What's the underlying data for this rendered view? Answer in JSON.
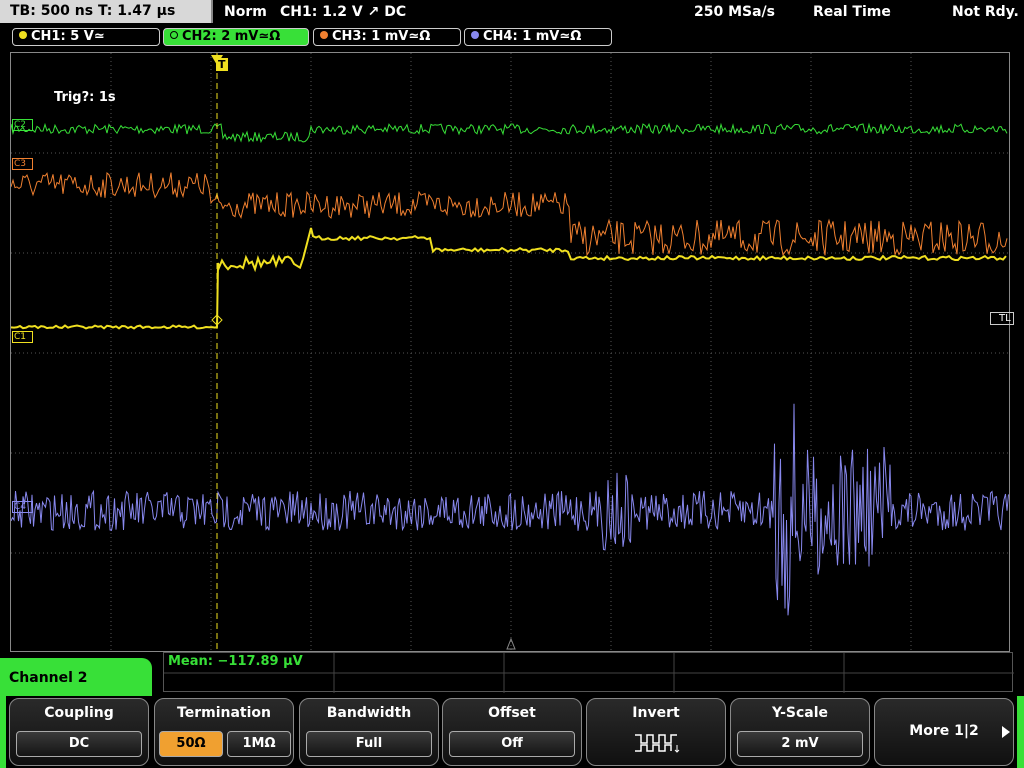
{
  "topbar": {
    "timebase": "TB: 500 ns   T: 1.47 µs",
    "trigger_mode": "Norm",
    "trigger_info": "CH1: 1.2 V ↗ DC",
    "sample_rate": "250 MSa/s",
    "acq_mode": "Real Time",
    "status": "Not Rdy."
  },
  "channels": [
    {
      "label": "CH1: 5 V≃",
      "color": "#f0e020"
    },
    {
      "label": "CH2: 2 mV≃Ω",
      "color": "#38e038"
    },
    {
      "label": "CH3: 1 mV≃Ω",
      "color": "#f08030"
    },
    {
      "label": "CH4: 1 mV≃Ω",
      "color": "#8888ee"
    }
  ],
  "screen": {
    "trig_timer": "Trig?: 1s",
    "marker_c1": "C1",
    "marker_c2": "C2",
    "marker_c3": "C3",
    "marker_c4": "C4",
    "marker_tl": "TL",
    "trigger_marker": "T"
  },
  "measurement": {
    "mean": "Mean: −117.89 µV"
  },
  "menu": {
    "title": "Channel 2",
    "coupling": {
      "title": "Coupling",
      "value": "DC"
    },
    "termination": {
      "title": "Termination",
      "opt1": "50Ω",
      "opt2": "1MΩ"
    },
    "bandwidth": {
      "title": "Bandwidth",
      "value": "Full"
    },
    "offset": {
      "title": "Offset",
      "value": "Off"
    },
    "invert": {
      "title": "Invert"
    },
    "yscale": {
      "title": "Y-Scale",
      "value": "2 mV"
    },
    "more": {
      "title": "More 1|2"
    }
  }
}
